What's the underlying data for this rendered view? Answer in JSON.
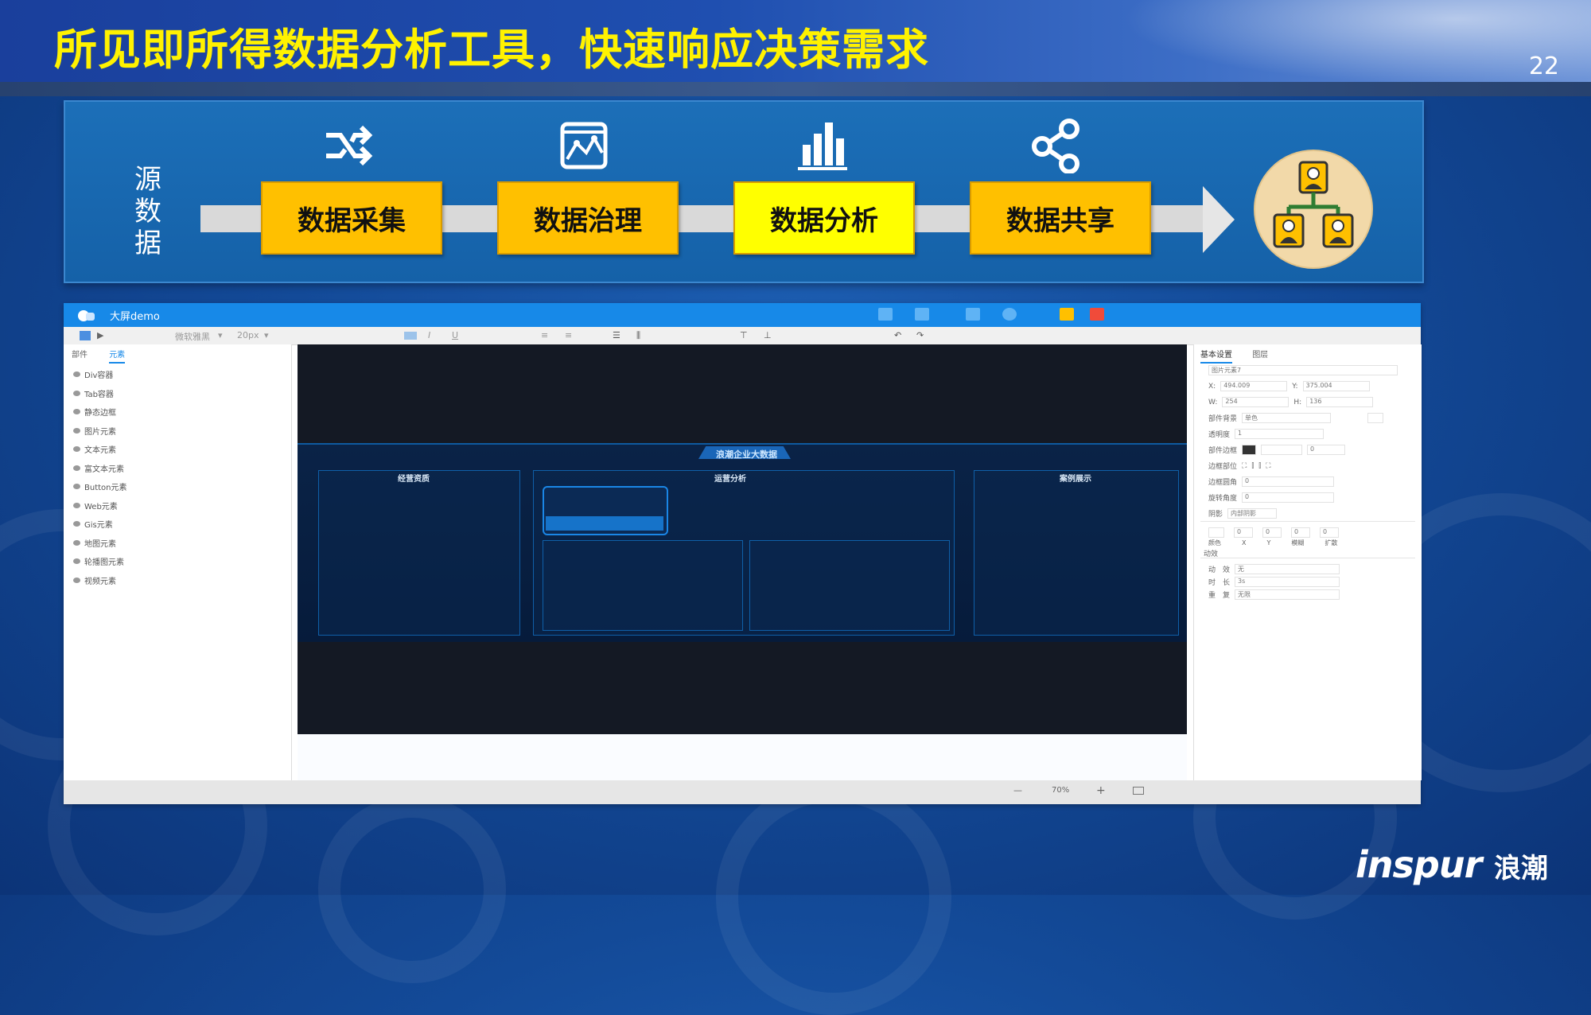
{
  "slide": {
    "title": "所见即所得数据分析工具，快速响应决策需求",
    "page_number": "22",
    "brand": "inspur",
    "brand_cn": "浪潮"
  },
  "flow": {
    "source_label": [
      "源",
      "数",
      "据"
    ],
    "stages": [
      {
        "label": "数据采集",
        "icon": "shuffle-icon",
        "active": false
      },
      {
        "label": "数据治理",
        "icon": "image-frame-icon",
        "active": false
      },
      {
        "label": "数据分析",
        "icon": "bar-chart-icon",
        "active": true
      },
      {
        "label": "数据共享",
        "icon": "share-icon",
        "active": false
      }
    ],
    "stage_colors": {
      "normal": "#ffc000",
      "active": "#ffff00"
    },
    "end_icon": "org-chart-people-icon"
  },
  "app": {
    "title": "大屏demo",
    "titlebar_color": "#1789e8",
    "titlebar_buttons": [
      "export-icon",
      "save-icon",
      "preview-icon",
      "refresh-icon",
      "theme-icon",
      "power-icon"
    ],
    "toolbar": {
      "font": "微软雅黑",
      "font_size": "20px"
    },
    "left_tabs": [
      "部件",
      "元素"
    ],
    "components": [
      "Div容器",
      "Tab容器",
      "静态边框",
      "图片元素",
      "文本元素",
      "富文本元素",
      "Button元素",
      "Web元素",
      "Gis元素",
      "地图元素",
      "轮播图元素",
      "视频元素"
    ],
    "dashboard": {
      "title": "浪潮企业大数据",
      "panels": [
        "经营资质",
        "运营分析",
        "案例展示"
      ]
    },
    "zoom": "70%",
    "right_panel": {
      "tabs": [
        "基本设置",
        "图层"
      ],
      "element_name": "图片元素7",
      "x_label": "X:",
      "x": "494.009",
      "y_label": "Y:",
      "y": "375.004",
      "w_label": "W:",
      "w": "254",
      "h_label": "H:",
      "h": "136",
      "bg_label": "部件背景",
      "bg_value": "单色",
      "opacity_label": "透明度",
      "opacity_value": "1",
      "border_label": "部件边框",
      "border_value": "0",
      "border_pos_label": "边框部位",
      "radius_label": "边框圆角",
      "radius_value": "0",
      "rotate_label": "旋转角度",
      "rotate_value": "0",
      "shadow_label": "阴影",
      "shadow_value": "内部阴影",
      "shadow_fields": [
        "颜色",
        "X",
        "Y",
        "模糊",
        "扩散"
      ],
      "shadow_values": [
        "0",
        "0",
        "0",
        "0"
      ],
      "anim_section": "动效",
      "anim_label": "动　效",
      "anim_value": "无",
      "dur_label": "时　长",
      "dur_value": "3s",
      "repeat_label": "重　复",
      "repeat_value": "无限"
    }
  }
}
